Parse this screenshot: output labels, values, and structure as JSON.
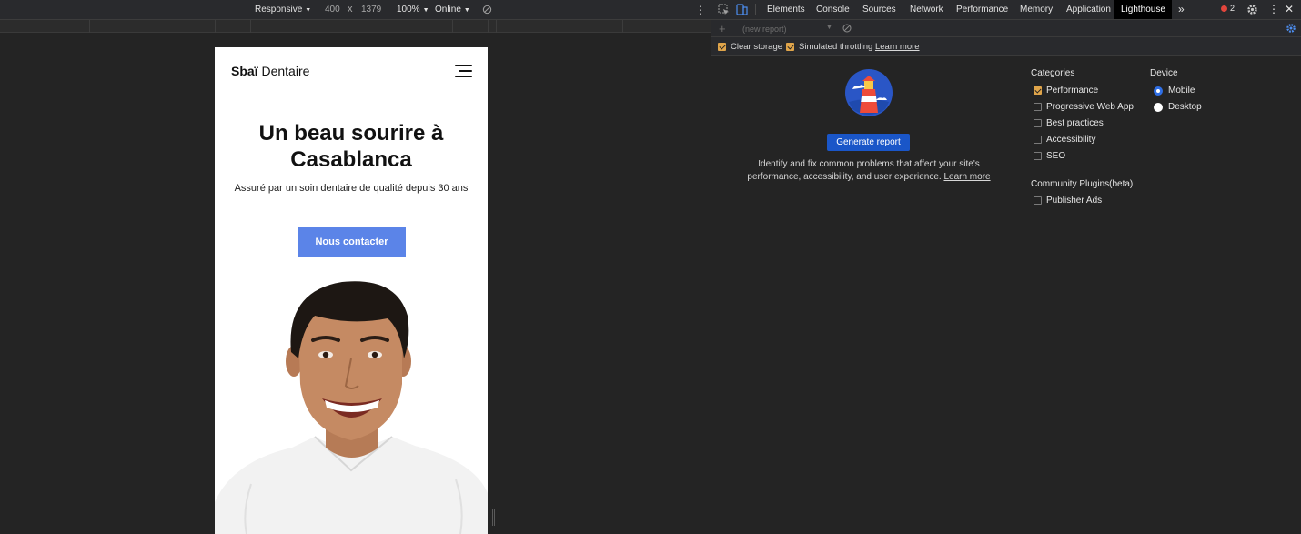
{
  "emulation": {
    "device": "Responsive",
    "width": "400",
    "times": "x",
    "height": "1379",
    "zoom": "100%",
    "network": "Online"
  },
  "site": {
    "brand_bold": "Sbaï",
    "brand_rest": "Dentaire",
    "hero_title_line1": "Un beau sourire à",
    "hero_title_line2": "Casablanca",
    "hero_subtitle": "Assuré par un soin dentaire de qualité depuis 30 ans",
    "cta_label": "Nous contacter",
    "cta_color": "#5b84e8"
  },
  "devtools": {
    "tabs": [
      "Elements",
      "Console",
      "Sources",
      "Network",
      "Performance",
      "Memory",
      "Application",
      "Lighthouse"
    ],
    "active_tab": "Lighthouse",
    "more_tabs": "»",
    "error_count": "2",
    "report_select": "(new report)",
    "options": {
      "clear_storage": "Clear storage",
      "simulated_throttling": "Simulated throttling",
      "learn_more": "Learn more"
    },
    "lighthouse": {
      "generate_label": "Generate report",
      "description": "Identify and fix common problems that affect your site's performance, accessibility, and user experience.",
      "learn_more": "Learn more",
      "categories_title": "Categories",
      "categories": [
        {
          "label": "Performance",
          "checked": true
        },
        {
          "label": "Progressive Web App",
          "checked": false
        },
        {
          "label": "Best practices",
          "checked": false
        },
        {
          "label": "Accessibility",
          "checked": false
        },
        {
          "label": "SEO",
          "checked": false
        }
      ],
      "plugins_title": "Community Plugins(beta)",
      "plugins": [
        {
          "label": "Publisher Ads",
          "checked": false
        }
      ],
      "device_title": "Device",
      "devices": [
        {
          "label": "Mobile",
          "selected": true
        },
        {
          "label": "Desktop",
          "selected": false
        }
      ]
    },
    "accent_color": "#1a56c8",
    "checkbox_color": "#e0a54a"
  }
}
